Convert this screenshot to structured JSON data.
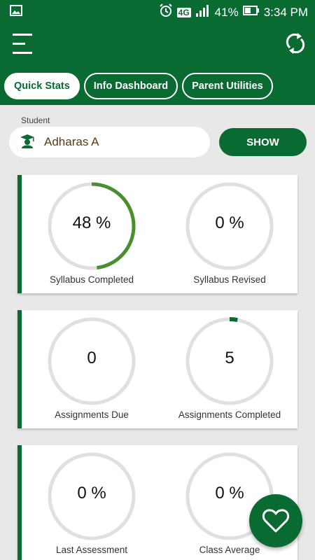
{
  "status_bar": {
    "battery": "41%",
    "time": "3:34 PM",
    "network": "4G"
  },
  "tabs": [
    {
      "label": "Quick Stats"
    },
    {
      "label": "Info Dashboard"
    },
    {
      "label": "Parent Utilities"
    }
  ],
  "student": {
    "label": "Student",
    "name": "Adharas A"
  },
  "show_button": {
    "label": "SHOW"
  },
  "cards": [
    {
      "stats": [
        {
          "value": "48 %",
          "label": "Syllabus Completed",
          "progress": 0.48
        },
        {
          "value": "0 %",
          "label": "Syllabus Revised",
          "progress": 0
        }
      ]
    },
    {
      "stats": [
        {
          "value": "0",
          "label": "Assignments Due",
          "progress": 0
        },
        {
          "value": "5",
          "label": "Assignments Completed",
          "progress": 0.03
        }
      ]
    },
    {
      "stats": [
        {
          "value": "0 %",
          "label": "Last Assessment",
          "progress": 0
        },
        {
          "value": "0 %",
          "label": "Class Average",
          "progress": 0
        }
      ]
    }
  ],
  "colors": {
    "primary": "#0a6b32",
    "ring_track": "#e0e0e0",
    "ring_progress": "#4a8f2f",
    "ring_progress_dark": "#0a6b32"
  },
  "icons": [
    "image-icon",
    "alarm-icon",
    "signal-icon",
    "battery-icon",
    "menu-icon",
    "refresh-icon",
    "graduate-icon",
    "heart-icon"
  ]
}
